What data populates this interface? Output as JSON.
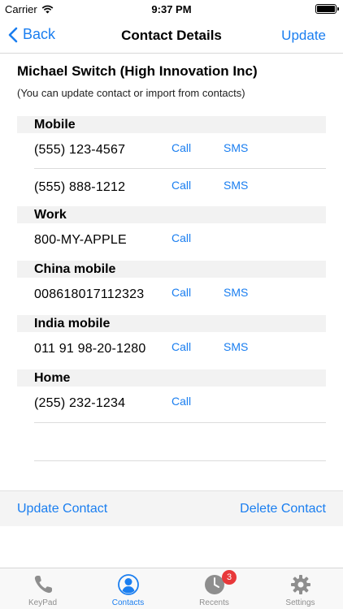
{
  "status_bar": {
    "carrier": "Carrier",
    "time": "9:37 PM"
  },
  "nav": {
    "back_label": "Back",
    "title": "Contact Details",
    "update_label": "Update"
  },
  "contact": {
    "name": "Michael Switch (High Innovation Inc)",
    "hint": "(You can update contact or import from contacts)"
  },
  "sections": [
    {
      "label": "Mobile",
      "rows": [
        {
          "number": "(555) 123-4567",
          "call": "Call",
          "sms": "SMS"
        },
        {
          "number": "(555) 888-1212",
          "call": "Call",
          "sms": "SMS"
        }
      ]
    },
    {
      "label": "Work",
      "rows": [
        {
          "number": "800-MY-APPLE",
          "call": "Call"
        }
      ]
    },
    {
      "label": "China mobile",
      "rows": [
        {
          "number": "008618017112323",
          "call": "Call",
          "sms": "SMS"
        }
      ]
    },
    {
      "label": "India mobile",
      "rows": [
        {
          "number": "011 91 98-20-1280",
          "call": "Call",
          "sms": "SMS"
        }
      ]
    },
    {
      "label": "Home",
      "rows": [
        {
          "number": "(255) 232-1234",
          "call": "Call"
        }
      ]
    }
  ],
  "actions": {
    "update_contact": "Update Contact",
    "delete_contact": "Delete Contact"
  },
  "tabs": [
    {
      "label": "KeyPad",
      "icon": "phone-icon"
    },
    {
      "label": "Contacts",
      "icon": "contacts-icon",
      "active": true
    },
    {
      "label": "Recents",
      "icon": "clock-icon",
      "badge": "3"
    },
    {
      "label": "Settings",
      "icon": "gear-icon"
    }
  ],
  "colors": {
    "accent": "#1a7ef0",
    "badge": "#e8383a",
    "inactive": "#8e8e8e"
  }
}
